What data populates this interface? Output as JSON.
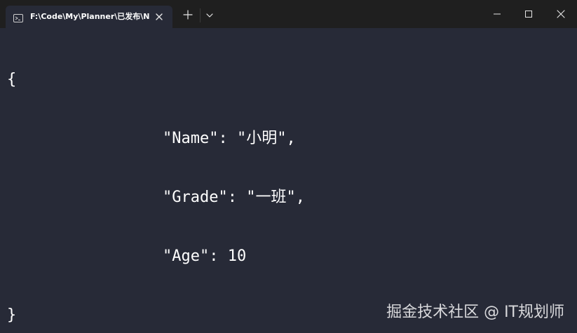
{
  "titlebar": {
    "tab_title": "F:\\Code\\My\\Planner\\已发布\\N",
    "icons": {
      "tab": "terminal-icon",
      "close_tab": "close-icon",
      "new_tab": "plus-icon",
      "dropdown": "chevron-down-icon",
      "minimize": "minimize-icon",
      "maximize": "maximize-icon",
      "close_window": "close-icon"
    }
  },
  "terminal": {
    "line_1": "{",
    "line_2": "\"Name\": \"小明\",",
    "line_3": "\"Grade\": \"一班\",",
    "line_4": "\"Age\": 10",
    "line_5": "}"
  },
  "watermark": {
    "text": "掘金技术社区 @ IT规划师"
  },
  "colors": {
    "background": "#272a37",
    "titlebar": "#1f1f1f",
    "text": "#ffffff"
  }
}
